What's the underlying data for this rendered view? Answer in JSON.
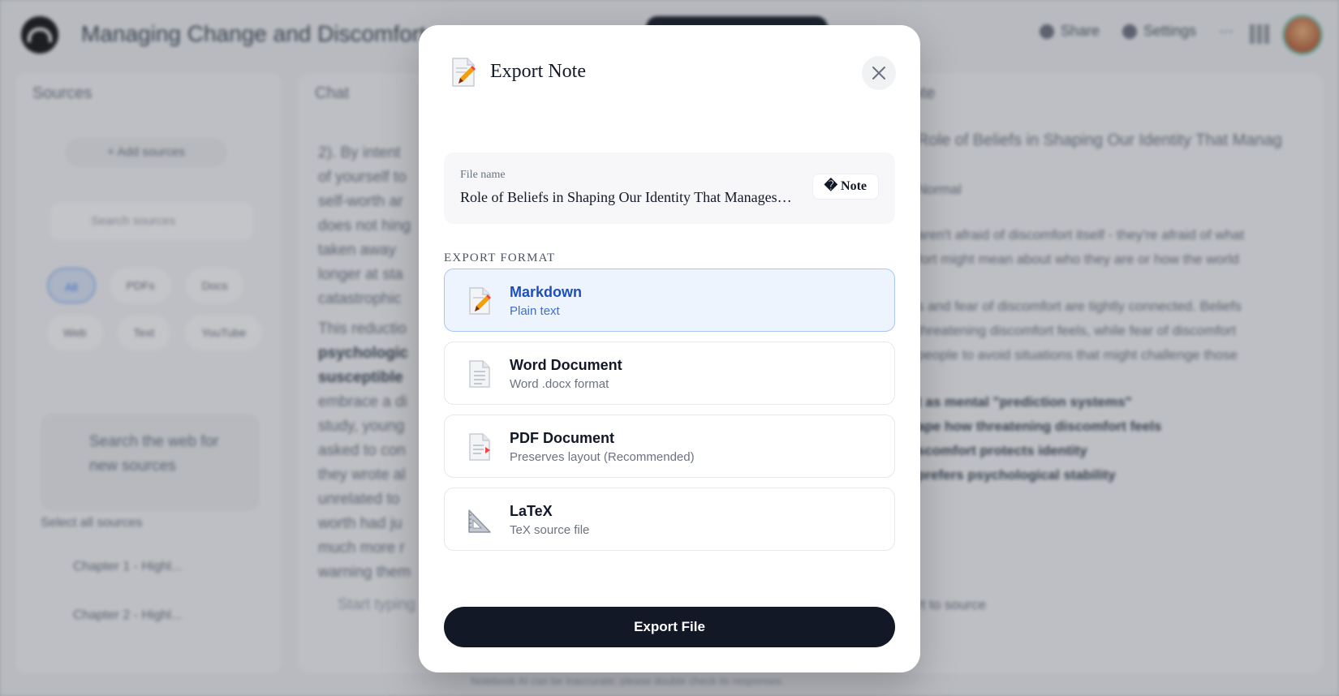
{
  "background": {
    "app_title": "Managing Change and Discomfort",
    "top_actions": [
      "Share",
      "Settings"
    ],
    "sources_panel": {
      "title": "Sources",
      "add_label": "+ Add sources",
      "search_placeholder": "Search sources",
      "chips": [
        "All",
        "PDFs",
        "Docs",
        "Web",
        "Text",
        "YouTube"
      ],
      "web_search_text": "Search the web for new sources",
      "select_all": "Select all sources",
      "items": [
        "Chapter 1 - Highl...",
        "Chapter 2 - Highl..."
      ]
    },
    "chat_panel": {
      "title": "Chat",
      "lines": [
        "2). By intent",
        "of yourself to",
        "self-worth ar",
        "does not hing",
        "taken away",
        "longer at sta",
        "catastrophic",
        "This reductio",
        "psychologic",
        "susceptible",
        "embrace a di",
        "study, young",
        "asked to con",
        "they wrote al",
        "unrelated to",
        "worth had ju",
        "much more r",
        "warning them"
      ],
      "input_placeholder": "Start typing"
    },
    "notes_panel": {
      "title": "Note",
      "note_title": "Role of Beliefs in Shaping Our Identity That Manag",
      "format_label": "Normal",
      "lines": [
        "aren't afraid of discomfort itself - they're afraid of what",
        "fort might mean about who they are or how the world",
        "s and fear of discomfort are tightly connected. Beliefs",
        "threatening discomfort feels, while fear of discomfort",
        "people to avoid situations that might challenge those",
        "t as mental \"prediction systems\"",
        "ape how threatening discomfort feels",
        "scomfort protects identity",
        "prefers psychological stability"
      ],
      "convert_label": "rt to source"
    },
    "footer": "Notebook AI can be inaccurate; please double check its responses."
  },
  "modal": {
    "title": "Export Note",
    "file_name_label": "File name",
    "file_name_value": "Role of Beliefs in Shaping Our Identity That Manages Fear of Discomfort",
    "note_badge": "� Note",
    "section_label": "EXPORT FORMAT",
    "formats": [
      {
        "name": "Markdown",
        "desc": "Plain text",
        "icon": "pencil-note-icon",
        "selected": true
      },
      {
        "name": "Word Document",
        "desc": "Word .docx format",
        "icon": "document-icon",
        "selected": false
      },
      {
        "name": "PDF Document",
        "desc": "Preserves layout (Recommended)",
        "icon": "pdf-document-icon",
        "selected": false
      },
      {
        "name": "LaTeX",
        "desc": "TeX source file",
        "icon": "triangle-ruler-icon",
        "selected": false
      }
    ],
    "export_button": "Export File",
    "accent_color": "#1e4fb8",
    "button_color": "#121826"
  }
}
